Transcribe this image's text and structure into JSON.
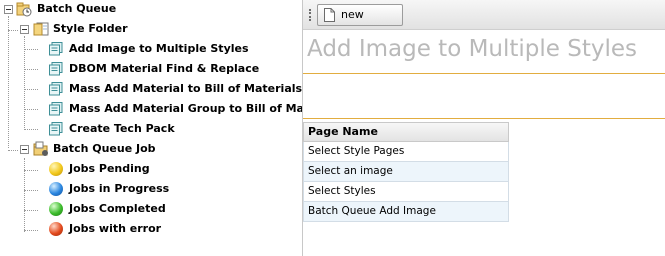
{
  "tree": {
    "root": {
      "label": "Batch Queue",
      "icon": "batch-queue-icon"
    },
    "style_folder": {
      "label": "Style Folder",
      "icon": "folder-icon",
      "items": [
        {
          "label": "Add Image to Multiple Styles",
          "icon": "page-icon"
        },
        {
          "label": "DBOM Material Find & Replace",
          "icon": "page-icon"
        },
        {
          "label": "Mass Add Material to Bill of Materials",
          "icon": "page-icon"
        },
        {
          "label": "Mass Add Material Group to Bill of Material",
          "icon": "page-icon"
        },
        {
          "label": "Create Tech Pack",
          "icon": "page-icon"
        }
      ]
    },
    "batch_queue_job": {
      "label": "Batch Queue Job",
      "icon": "job-folder-icon",
      "items": [
        {
          "label": "Jobs Pending",
          "icon": "yellow-status-icon",
          "color": "#f2c81c"
        },
        {
          "label": "Jobs in Progress",
          "icon": "blue-status-icon",
          "color": "#2a86e0"
        },
        {
          "label": "Jobs Completed",
          "icon": "green-status-icon",
          "color": "#3cbc2c"
        },
        {
          "label": "Jobs with error",
          "icon": "red-status-icon",
          "color": "#e34a1e"
        }
      ]
    }
  },
  "toolbar": {
    "new_label": "new"
  },
  "main": {
    "title": "Add Image to Multiple Styles",
    "grid": {
      "header": "Page Name",
      "rows": [
        "Select Style Pages",
        "Select an image",
        "Select Styles",
        "Batch Queue Add Image"
      ]
    }
  },
  "colors": {
    "accent_rule": "#e2ad40",
    "title_text": "#b9b9b9",
    "row_alt": "#edf5fb"
  }
}
